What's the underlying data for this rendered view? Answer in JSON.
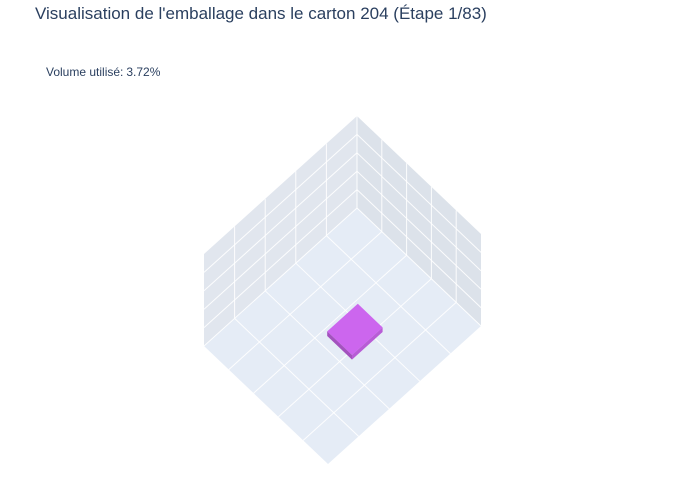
{
  "chart_data": {
    "type": "3d-box-packing",
    "title": "Visualisation de l'emballage dans le carton 204 (Étape 1/83)",
    "annotation": {
      "label": "Volume utilisé:",
      "value": "3.72%"
    },
    "grid": true,
    "grid_divisions": 5,
    "scene_background": "#e5ecf6",
    "gridline_color": "#ffffff",
    "boxes": [
      {
        "color": "#cc66ee",
        "x": [
          2.0,
          3.0
        ],
        "y": [
          2.5,
          3.5
        ],
        "z": [
          0.75,
          1.0
        ]
      }
    ]
  }
}
